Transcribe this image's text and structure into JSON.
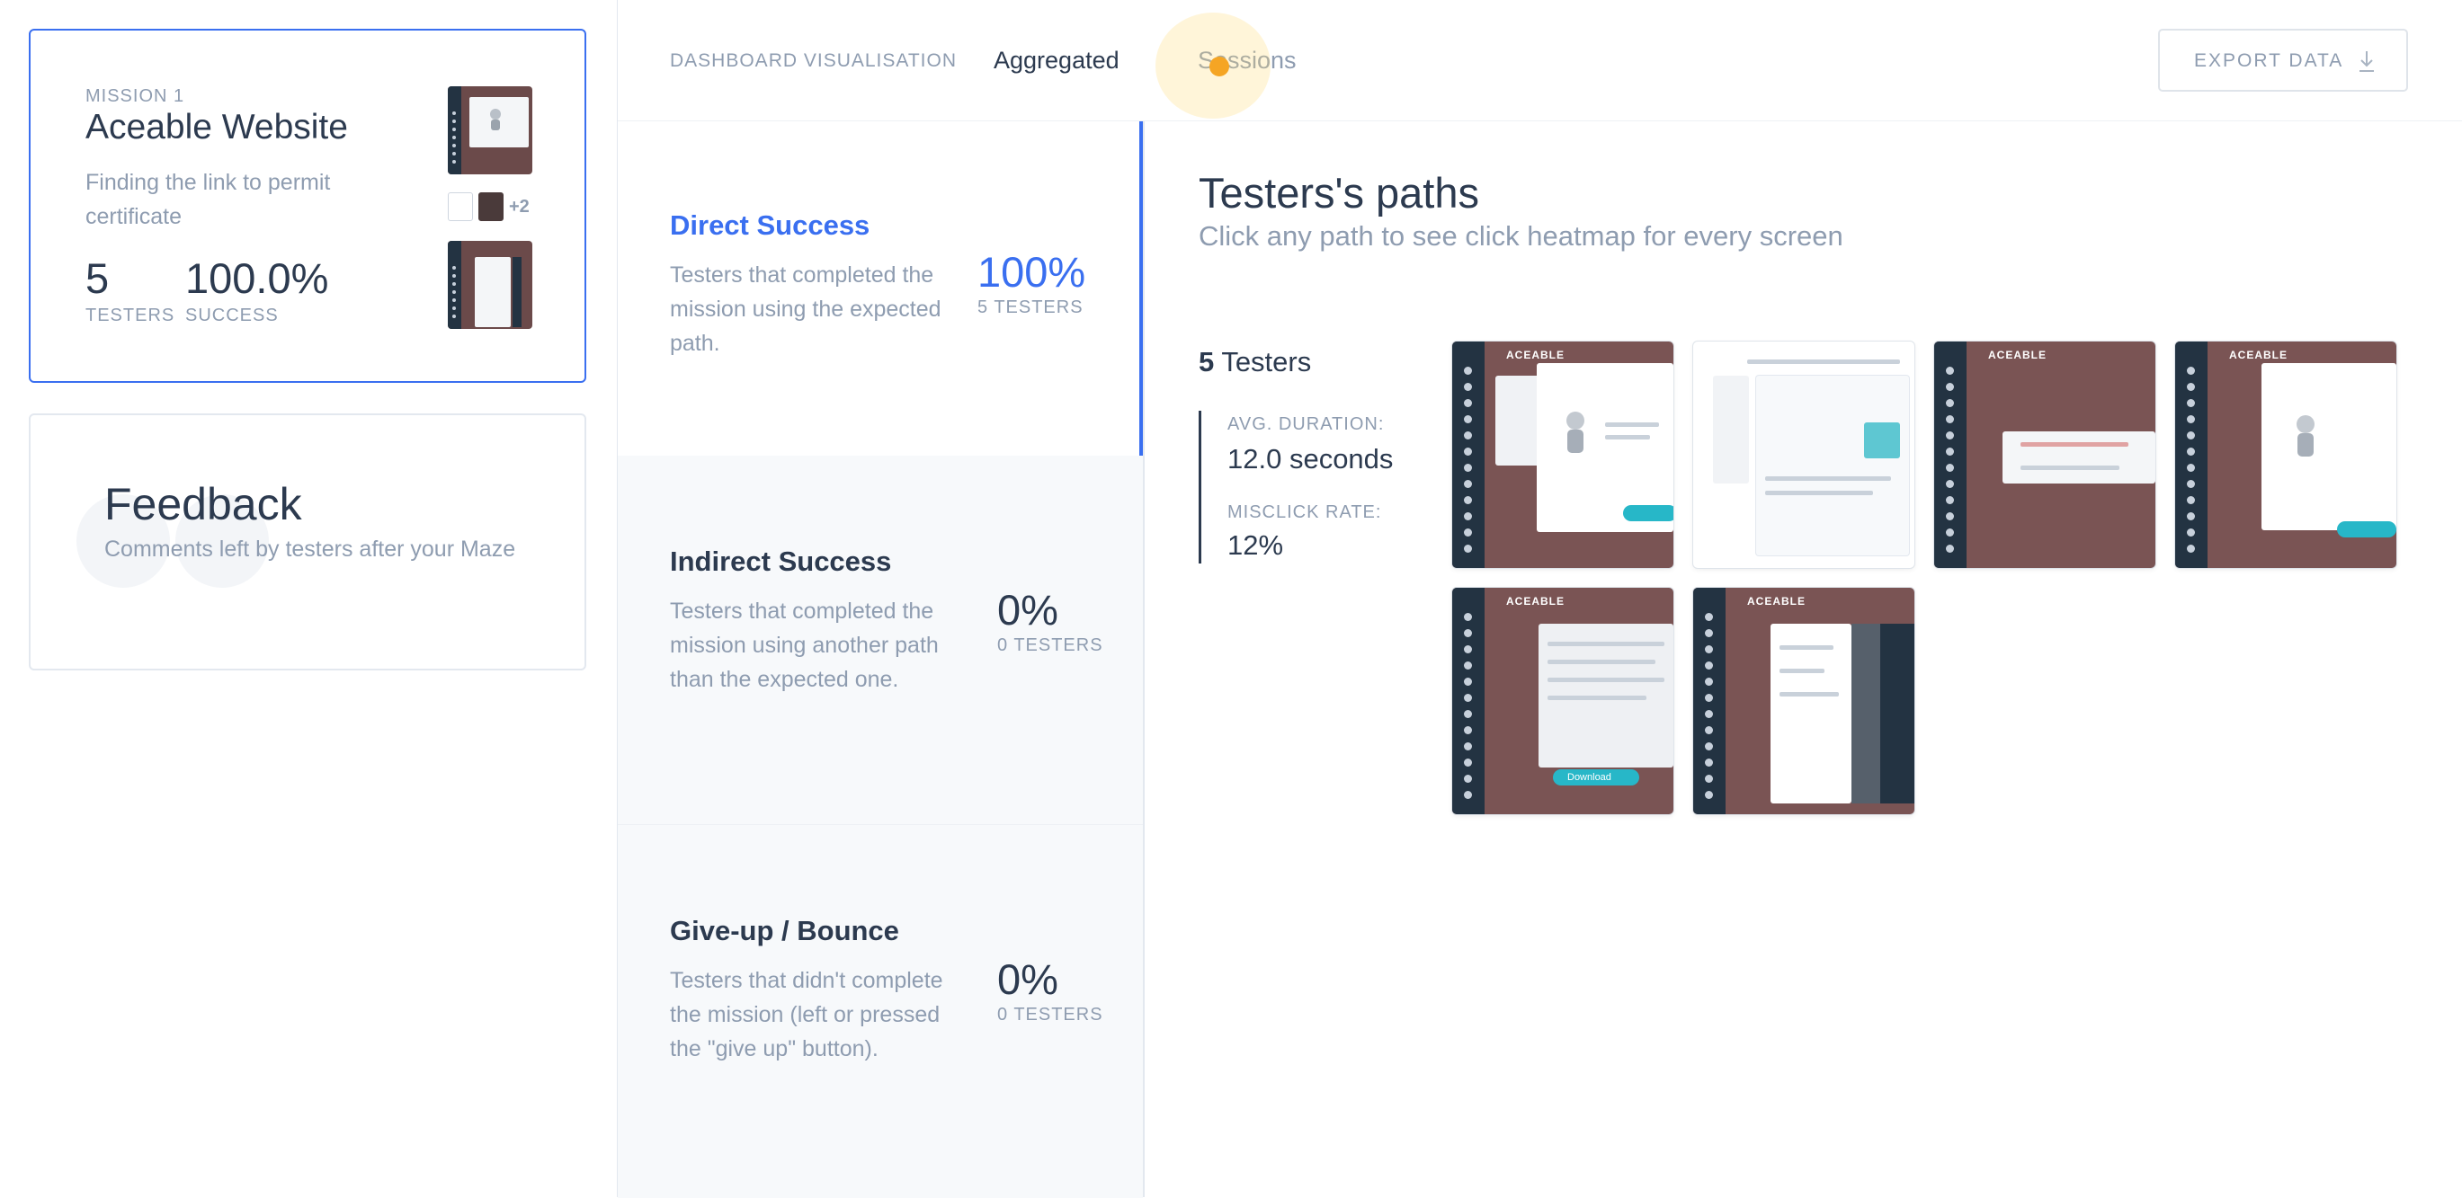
{
  "mission": {
    "kicker": "MISSION 1",
    "title": "Aceable Website",
    "description": "Finding the link to permit certificate",
    "testers_value": "5",
    "testers_label": "TESTERS",
    "success_value": "100.0%",
    "success_label": "SUCCESS",
    "more_screens": "+2"
  },
  "feedback": {
    "title": "Feedback",
    "description": "Comments left by testers after your Maze"
  },
  "header": {
    "tab_visualisation": "DASHBOARD VISUALISATION",
    "tab_aggregated": "Aggregated",
    "tab_sessions": "Sessions",
    "export_label": "EXPORT DATA"
  },
  "outcomes": [
    {
      "title": "Direct Success",
      "description": "Testers that completed the mission using the expected path.",
      "percent": "100%",
      "count": "5 TESTERS"
    },
    {
      "title": "Indirect Success",
      "description": "Testers that completed the mission using another path than the expected one.",
      "percent": "0%",
      "count": "0 TESTERS"
    },
    {
      "title": "Give-up / Bounce",
      "description": "Testers that didn't complete the mission (left or pressed the \"give up\" button).",
      "percent": "0%",
      "count": "0 TESTERS"
    }
  ],
  "paths": {
    "title": "Testers's paths",
    "subtitle": "Click any path to see click heatmap for every screen",
    "testers_count": "5",
    "testers_label": "Testers",
    "avg_duration_label": "AVG. DURATION:",
    "avg_duration_value": "12.0 seconds",
    "misclick_label": "MISCLICK RATE:",
    "misclick_value": "12%",
    "screen_brand": "ACEABLE",
    "screen_button": "Download"
  },
  "colors": {
    "accent": "#3a6ff0",
    "text_primary": "#2c3a4f",
    "text_muted": "#8e9cb0",
    "cursor": "#f5a524",
    "teal": "#27b7c8",
    "sidebar_dark": "#233342"
  },
  "icons": [
    "download-icon",
    "quote-icon",
    "cursor-indicator"
  ]
}
